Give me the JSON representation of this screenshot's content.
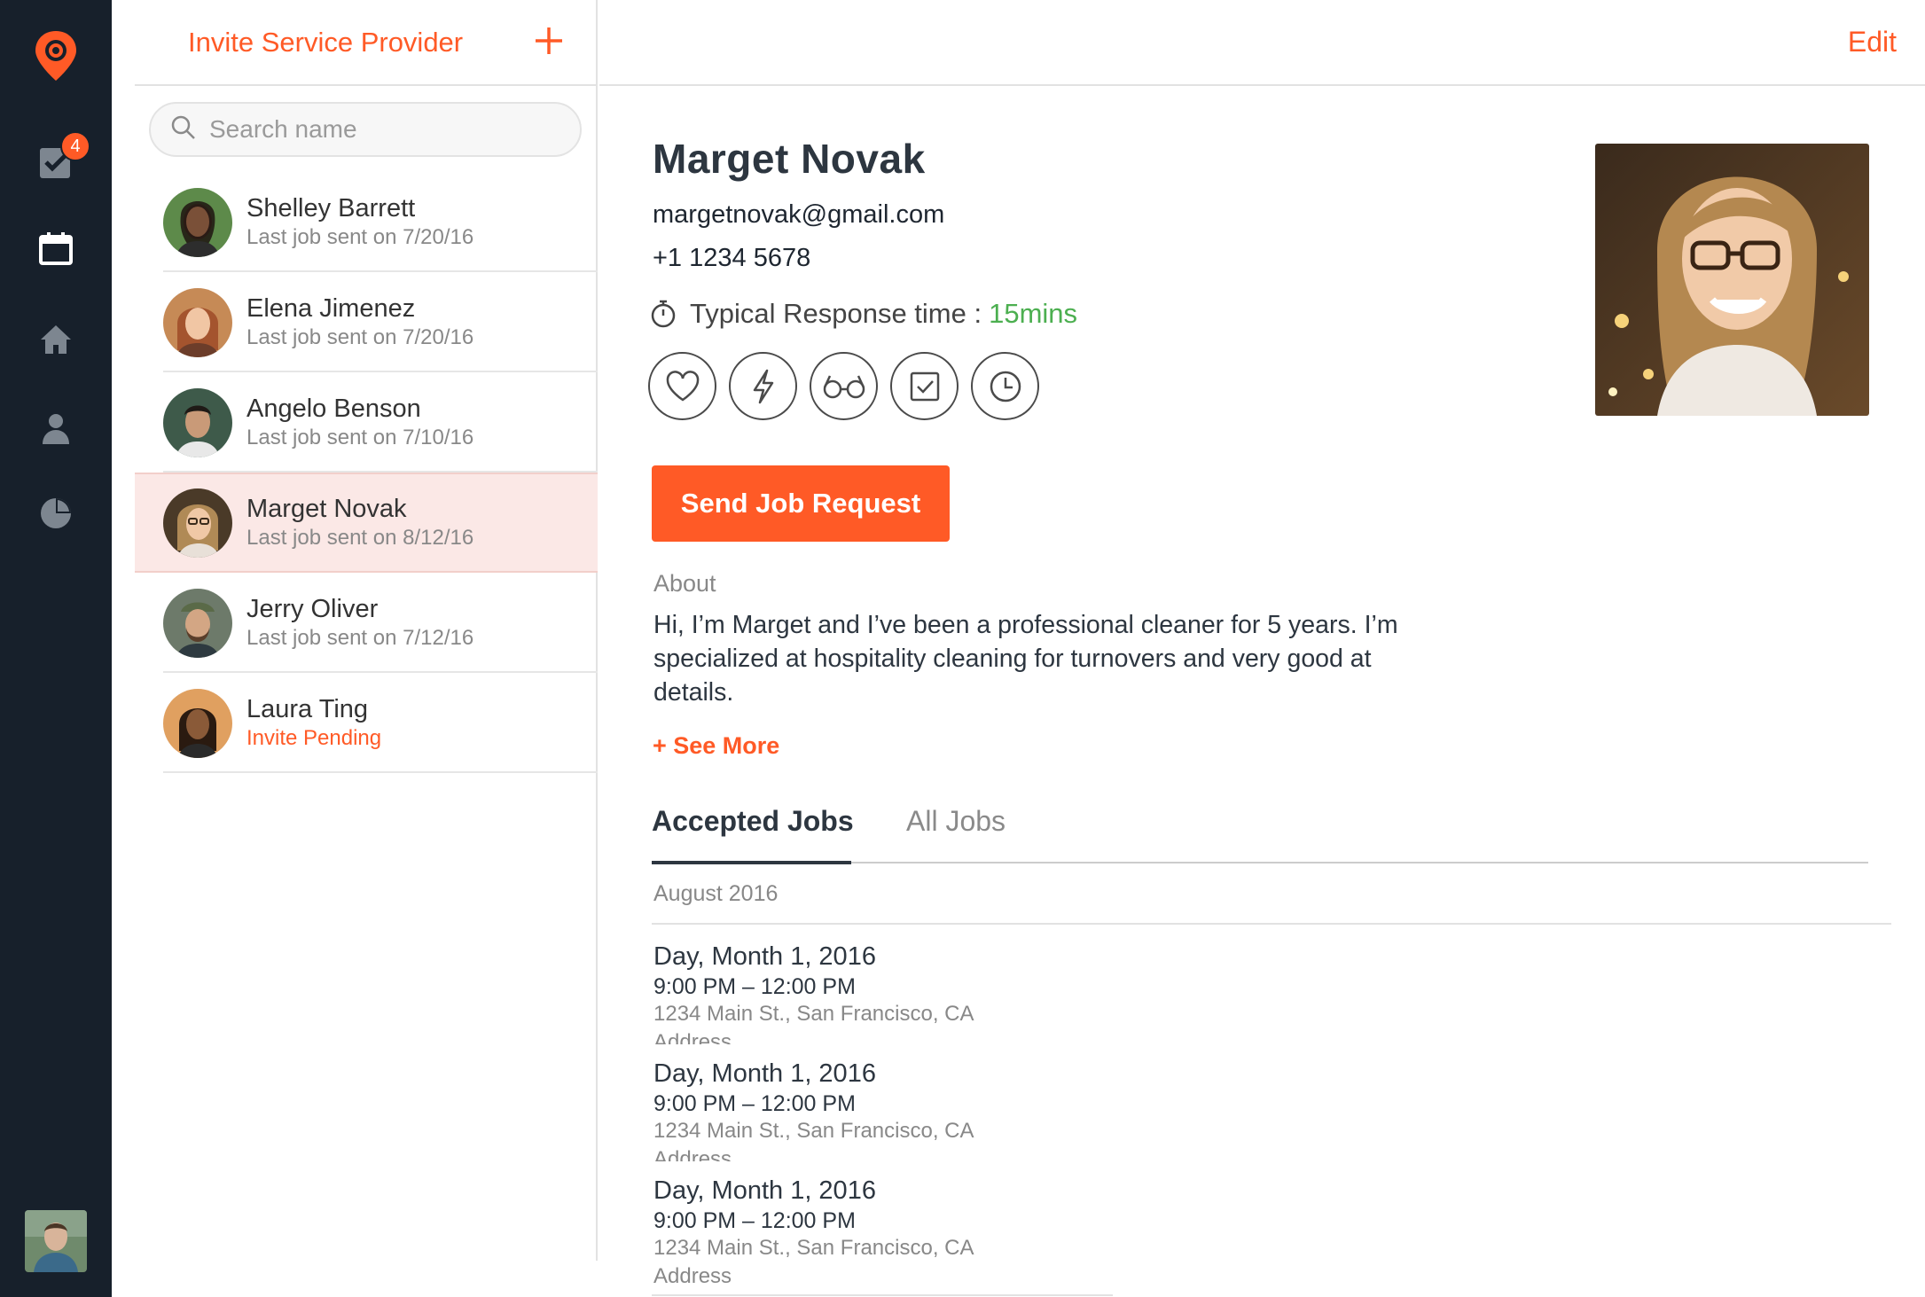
{
  "rail": {
    "badge_count": "4",
    "icons": [
      "location-pin-logo",
      "tasks-check-icon",
      "calendar-icon",
      "home-icon",
      "person-icon",
      "pie-chart-icon"
    ]
  },
  "list": {
    "title": "Invite Service Provider",
    "add_icon": "plus-icon",
    "search_placeholder": "Search name",
    "contacts": [
      {
        "name": "Shelley Barrett",
        "sub": "Last job sent on 7/20/16"
      },
      {
        "name": "Elena Jimenez",
        "sub": "Last job sent on 7/20/16"
      },
      {
        "name": "Angelo Benson",
        "sub": "Last job sent on 7/10/16"
      },
      {
        "name": "Marget Novak",
        "sub": "Last job sent on 8/12/16"
      },
      {
        "name": "Jerry Oliver",
        "sub": "Last job sent on 7/12/16"
      },
      {
        "name": "Laura Ting",
        "sub": "Invite Pending"
      }
    ]
  },
  "detail": {
    "edit_label": "Edit",
    "name": "Marget Novak",
    "email": "margetnovak@gmail.com",
    "phone": "+1 1234 5678",
    "response_label": "Typical Response time :",
    "response_value": "15mins",
    "badge_icons": [
      "heart-icon",
      "lightning-icon",
      "glasses-icon",
      "checkbox-icon",
      "clock-icon"
    ],
    "send_button": "Send Job Request",
    "about_label": "About",
    "about_text": "Hi, I’m Marget and I’ve been a professional cleaner for 5 years. I’m specialized at hospitality cleaning for turnovers and very good at details.",
    "see_more": "+ See More",
    "tabs": {
      "accepted": "Accepted Jobs",
      "all": "All Jobs"
    },
    "month": "August 2016",
    "jobs": [
      {
        "date": "Day, Month 1, 2016",
        "time": "9:00 PM – 12:00 PM",
        "address": "1234 Main St., San Francisco, CA",
        "label": "Address"
      },
      {
        "date": "Day, Month 1, 2016",
        "time": "9:00 PM – 12:00 PM",
        "address": "1234 Main St., San Francisco, CA",
        "label": "Address"
      },
      {
        "date": "Day, Month 1, 2016",
        "time": "9:00 PM – 12:00 PM",
        "address": "1234 Main St., San Francisco, CA",
        "label": "Address"
      }
    ]
  },
  "colors": {
    "accent": "#ff5a26",
    "rail_bg": "#17202b",
    "selected_row": "#fbe8e6",
    "response_green": "#4caf50"
  }
}
